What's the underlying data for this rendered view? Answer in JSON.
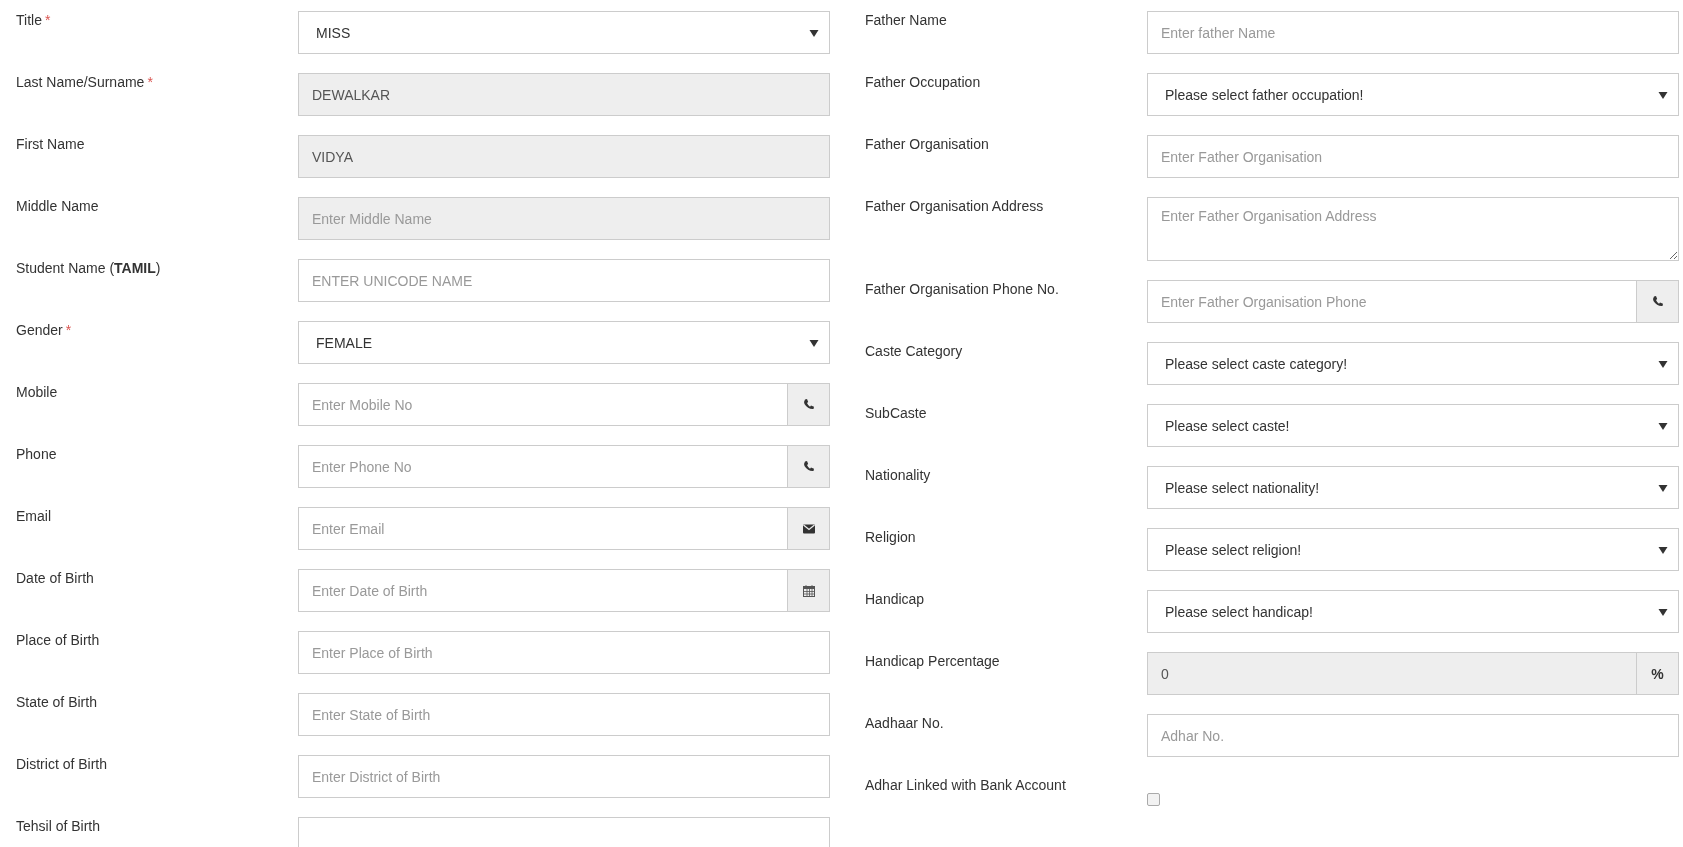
{
  "left": [
    {
      "kind": "select",
      "label": "Title",
      "mark": "*",
      "value": "MISS"
    },
    {
      "kind": "text",
      "label": "Last Name/Surname",
      "mark": "*",
      "value": "DEWALKAR",
      "disabled": true
    },
    {
      "kind": "text",
      "label": "First Name",
      "value": "VIDYA",
      "disabled": true
    },
    {
      "kind": "text",
      "label": "Middle Name",
      "placeholder": "Enter Middle Name",
      "disabled": true
    },
    {
      "kind": "text",
      "label": "Student Name (**TAMIL**)",
      "placeholder": "ENTER UNICODE NAME",
      "disabled": false
    },
    {
      "kind": "select",
      "label": "Gender",
      "mark": "*",
      "value": "FEMALE"
    },
    {
      "kind": "phone",
      "label": "Mobile",
      "placeholder": "Enter Mobile No",
      "disabled": false
    },
    {
      "kind": "phone",
      "label": "Phone",
      "placeholder": "Enter Phone No",
      "disabled": false
    },
    {
      "kind": "email",
      "label": "Email",
      "placeholder": "Enter Email",
      "disabled": false
    },
    {
      "kind": "date",
      "label": "Date of Birth",
      "placeholder": "Enter Date of Birth",
      "disabled": false
    },
    {
      "kind": "text",
      "label": "Place of Birth",
      "placeholder": "Enter Place of Birth",
      "disabled": false
    },
    {
      "kind": "text",
      "label": "State of Birth",
      "placeholder": "Enter State of Birth",
      "disabled": false
    },
    {
      "kind": "text",
      "label": "District of Birth",
      "placeholder": "Enter District of Birth",
      "disabled": false
    },
    {
      "kind": "text",
      "label": "Tehsil of Birth",
      "disabled": false
    }
  ],
  "right": [
    {
      "kind": "text",
      "label": "Father Name",
      "placeholder": "Enter father Name",
      "disabled": false
    },
    {
      "kind": "select",
      "label": "Father Occupation",
      "value": "Please select father occupation!"
    },
    {
      "kind": "text",
      "label": "Father Organisation",
      "placeholder": "Enter Father Organisation",
      "disabled": false
    },
    {
      "kind": "textarea",
      "label": "Father Organisation Address",
      "placeholder": "Enter Father Organisation Address",
      "disabled": false
    },
    {
      "kind": "phone",
      "label": "Father Organisation Phone No.",
      "placeholder": "Enter Father Organisation Phone",
      "disabled": false
    },
    {
      "kind": "select",
      "label": "Caste Category",
      "value": "Please select caste category!"
    },
    {
      "kind": "select",
      "label": "SubCaste",
      "value": "Please select caste!"
    },
    {
      "kind": "select",
      "label": "Nationality",
      "value": "Please select nationality!"
    },
    {
      "kind": "select",
      "label": "Religion",
      "value": "Please select religion!"
    },
    {
      "kind": "select",
      "label": "Handicap",
      "value": "Please select handicap!"
    },
    {
      "kind": "unit",
      "label": "Handicap Percentage",
      "value": "0",
      "unit": "%",
      "disabled": true
    },
    {
      "kind": "text",
      "label": "Aadhaar No.",
      "placeholder": "Adhar No.",
      "disabled": false
    },
    {
      "kind": "checkbox",
      "label": "Adhar Linked with Bank Account",
      "checked": false
    }
  ]
}
